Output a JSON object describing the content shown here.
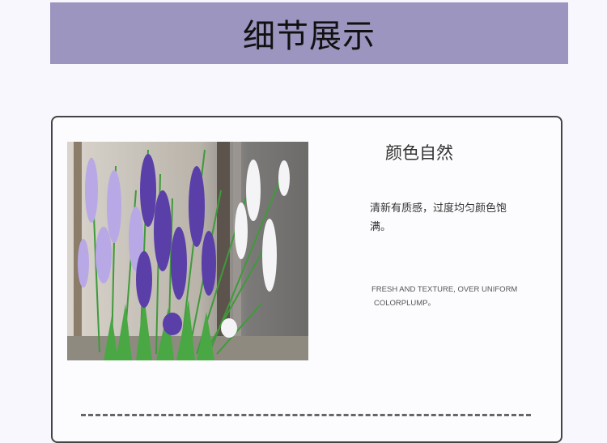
{
  "banner": {
    "title": "细节展示",
    "background": "#9b95bf"
  },
  "detail": {
    "heading": "颜色自然",
    "description_cn": "清新有质感，过度均匀颜色饱满。",
    "description_en_line1": "FRESH AND TEXTURE, OVER UNIFORM",
    "description_en_line2": "COLORPLUMP。"
  },
  "colors": {
    "lavender_purple": "#5a3fa8",
    "lavender_light": "#b9a8e6",
    "white_flower": "#f4f4f6",
    "stem_green": "#3f9a3a",
    "wall_gray": "#7a7a7a"
  }
}
